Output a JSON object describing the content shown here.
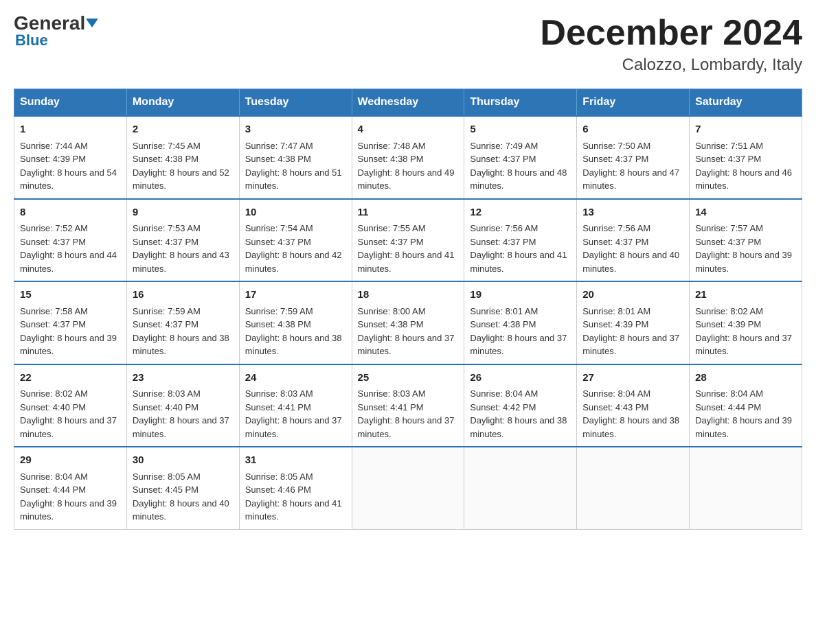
{
  "header": {
    "logo_general": "General",
    "logo_blue": "Blue",
    "title": "December 2024",
    "subtitle": "Calozzo, Lombardy, Italy"
  },
  "days_of_week": [
    "Sunday",
    "Monday",
    "Tuesday",
    "Wednesday",
    "Thursday",
    "Friday",
    "Saturday"
  ],
  "weeks": [
    [
      {
        "day": "1",
        "sunrise": "7:44 AM",
        "sunset": "4:39 PM",
        "daylight": "8 hours and 54 minutes."
      },
      {
        "day": "2",
        "sunrise": "7:45 AM",
        "sunset": "4:38 PM",
        "daylight": "8 hours and 52 minutes."
      },
      {
        "day": "3",
        "sunrise": "7:47 AM",
        "sunset": "4:38 PM",
        "daylight": "8 hours and 51 minutes."
      },
      {
        "day": "4",
        "sunrise": "7:48 AM",
        "sunset": "4:38 PM",
        "daylight": "8 hours and 49 minutes."
      },
      {
        "day": "5",
        "sunrise": "7:49 AM",
        "sunset": "4:37 PM",
        "daylight": "8 hours and 48 minutes."
      },
      {
        "day": "6",
        "sunrise": "7:50 AM",
        "sunset": "4:37 PM",
        "daylight": "8 hours and 47 minutes."
      },
      {
        "day": "7",
        "sunrise": "7:51 AM",
        "sunset": "4:37 PM",
        "daylight": "8 hours and 46 minutes."
      }
    ],
    [
      {
        "day": "8",
        "sunrise": "7:52 AM",
        "sunset": "4:37 PM",
        "daylight": "8 hours and 44 minutes."
      },
      {
        "day": "9",
        "sunrise": "7:53 AM",
        "sunset": "4:37 PM",
        "daylight": "8 hours and 43 minutes."
      },
      {
        "day": "10",
        "sunrise": "7:54 AM",
        "sunset": "4:37 PM",
        "daylight": "8 hours and 42 minutes."
      },
      {
        "day": "11",
        "sunrise": "7:55 AM",
        "sunset": "4:37 PM",
        "daylight": "8 hours and 41 minutes."
      },
      {
        "day": "12",
        "sunrise": "7:56 AM",
        "sunset": "4:37 PM",
        "daylight": "8 hours and 41 minutes."
      },
      {
        "day": "13",
        "sunrise": "7:56 AM",
        "sunset": "4:37 PM",
        "daylight": "8 hours and 40 minutes."
      },
      {
        "day": "14",
        "sunrise": "7:57 AM",
        "sunset": "4:37 PM",
        "daylight": "8 hours and 39 minutes."
      }
    ],
    [
      {
        "day": "15",
        "sunrise": "7:58 AM",
        "sunset": "4:37 PM",
        "daylight": "8 hours and 39 minutes."
      },
      {
        "day": "16",
        "sunrise": "7:59 AM",
        "sunset": "4:37 PM",
        "daylight": "8 hours and 38 minutes."
      },
      {
        "day": "17",
        "sunrise": "7:59 AM",
        "sunset": "4:38 PM",
        "daylight": "8 hours and 38 minutes."
      },
      {
        "day": "18",
        "sunrise": "8:00 AM",
        "sunset": "4:38 PM",
        "daylight": "8 hours and 37 minutes."
      },
      {
        "day": "19",
        "sunrise": "8:01 AM",
        "sunset": "4:38 PM",
        "daylight": "8 hours and 37 minutes."
      },
      {
        "day": "20",
        "sunrise": "8:01 AM",
        "sunset": "4:39 PM",
        "daylight": "8 hours and 37 minutes."
      },
      {
        "day": "21",
        "sunrise": "8:02 AM",
        "sunset": "4:39 PM",
        "daylight": "8 hours and 37 minutes."
      }
    ],
    [
      {
        "day": "22",
        "sunrise": "8:02 AM",
        "sunset": "4:40 PM",
        "daylight": "8 hours and 37 minutes."
      },
      {
        "day": "23",
        "sunrise": "8:03 AM",
        "sunset": "4:40 PM",
        "daylight": "8 hours and 37 minutes."
      },
      {
        "day": "24",
        "sunrise": "8:03 AM",
        "sunset": "4:41 PM",
        "daylight": "8 hours and 37 minutes."
      },
      {
        "day": "25",
        "sunrise": "8:03 AM",
        "sunset": "4:41 PM",
        "daylight": "8 hours and 37 minutes."
      },
      {
        "day": "26",
        "sunrise": "8:04 AM",
        "sunset": "4:42 PM",
        "daylight": "8 hours and 38 minutes."
      },
      {
        "day": "27",
        "sunrise": "8:04 AM",
        "sunset": "4:43 PM",
        "daylight": "8 hours and 38 minutes."
      },
      {
        "day": "28",
        "sunrise": "8:04 AM",
        "sunset": "4:44 PM",
        "daylight": "8 hours and 39 minutes."
      }
    ],
    [
      {
        "day": "29",
        "sunrise": "8:04 AM",
        "sunset": "4:44 PM",
        "daylight": "8 hours and 39 minutes."
      },
      {
        "day": "30",
        "sunrise": "8:05 AM",
        "sunset": "4:45 PM",
        "daylight": "8 hours and 40 minutes."
      },
      {
        "day": "31",
        "sunrise": "8:05 AM",
        "sunset": "4:46 PM",
        "daylight": "8 hours and 41 minutes."
      },
      null,
      null,
      null,
      null
    ]
  ]
}
